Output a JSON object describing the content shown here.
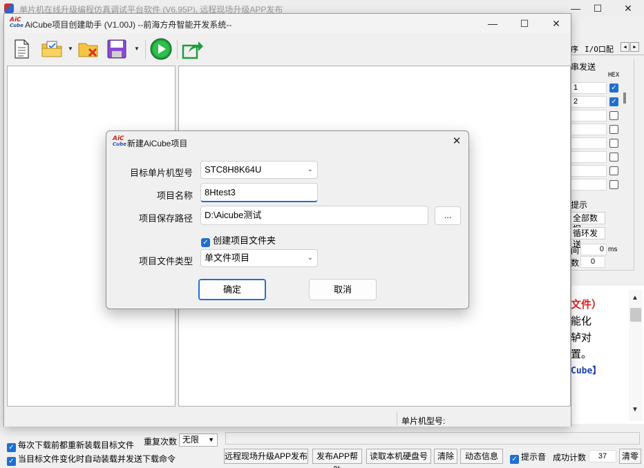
{
  "main_window": {
    "title": "单片机在线升级编程仿真调试平台软件 (V6.95P), 远程现场升级APP发布",
    "controls": {
      "minimize": "—",
      "maximize": "☐",
      "close": "✕"
    }
  },
  "bg_panel": {
    "tab_fragment": "序",
    "tab_io": "I/O口配",
    "nav_prev": "◀",
    "nav_next": "▶",
    "group_title": "串发送",
    "hex_label": "HEX",
    "rows": [
      {
        "value": "1",
        "checked": true
      },
      {
        "value": "2",
        "checked": true
      },
      {
        "value": "",
        "checked": false
      },
      {
        "value": "",
        "checked": false
      },
      {
        "value": "",
        "checked": false
      },
      {
        "value": "",
        "checked": false
      },
      {
        "value": "",
        "checked": false
      },
      {
        "value": "",
        "checked": false
      }
    ],
    "hint_label": "提示",
    "btn_all_data": "全部数据",
    "btn_loop_send": "循环发送",
    "interval_label": "间",
    "interval_value": "0",
    "interval_unit": "ms",
    "count_label": "数",
    "count_value": "0"
  },
  "bg_text": {
    "line1": "文件）",
    "line2": "能化",
    "line3": "轳对",
    "line4": "置。",
    "line5": "Cube】"
  },
  "bg_bottom": {
    "chk1": "每次下载前都重新装载目标文件",
    "chk2": "当目标文件变化时自动装载并发送下载命令",
    "repeat_label": "重复次数",
    "repeat_value": "无限",
    "btn_remote": "远程现场升级APP发布",
    "btn_publish_help": "发布APP帮助",
    "btn_read_disk": "读取本机硬盘号",
    "btn_clear": "清除",
    "btn_dynamic": "动态信息",
    "chk_sound": "提示音",
    "success_label": "成功计数",
    "success_count": "37",
    "btn_clear2": "清零"
  },
  "aicube": {
    "logo_top": "AiC",
    "logo_bottom": "Cube",
    "title": "AiCube项目创建助手 (V1.00J) --前海方舟智能开发系统--",
    "controls": {
      "minimize": "—",
      "maximize": "☐",
      "close": "✕"
    },
    "status_label": "单片机型号:"
  },
  "dialog": {
    "title": "新建AiCube项目",
    "close": "✕",
    "mcu_label": "目标单片机型号",
    "mcu_value": "STC8H8K64U",
    "name_label": "项目名称",
    "name_value": "8Htest3",
    "path_label": "项目保存路径",
    "path_value": "D:\\Aicube测试",
    "browse_label": "...",
    "create_folder_label": "创建项目文件夹",
    "filetype_label": "项目文件类型",
    "filetype_value": "单文件项目",
    "ok_label": "确定",
    "cancel_label": "取消"
  },
  "icons": [
    "new-file-icon",
    "open-folder-icon",
    "close-project-icon",
    "save-icon",
    "run-icon",
    "export-icon",
    "chevron-down-icon"
  ]
}
